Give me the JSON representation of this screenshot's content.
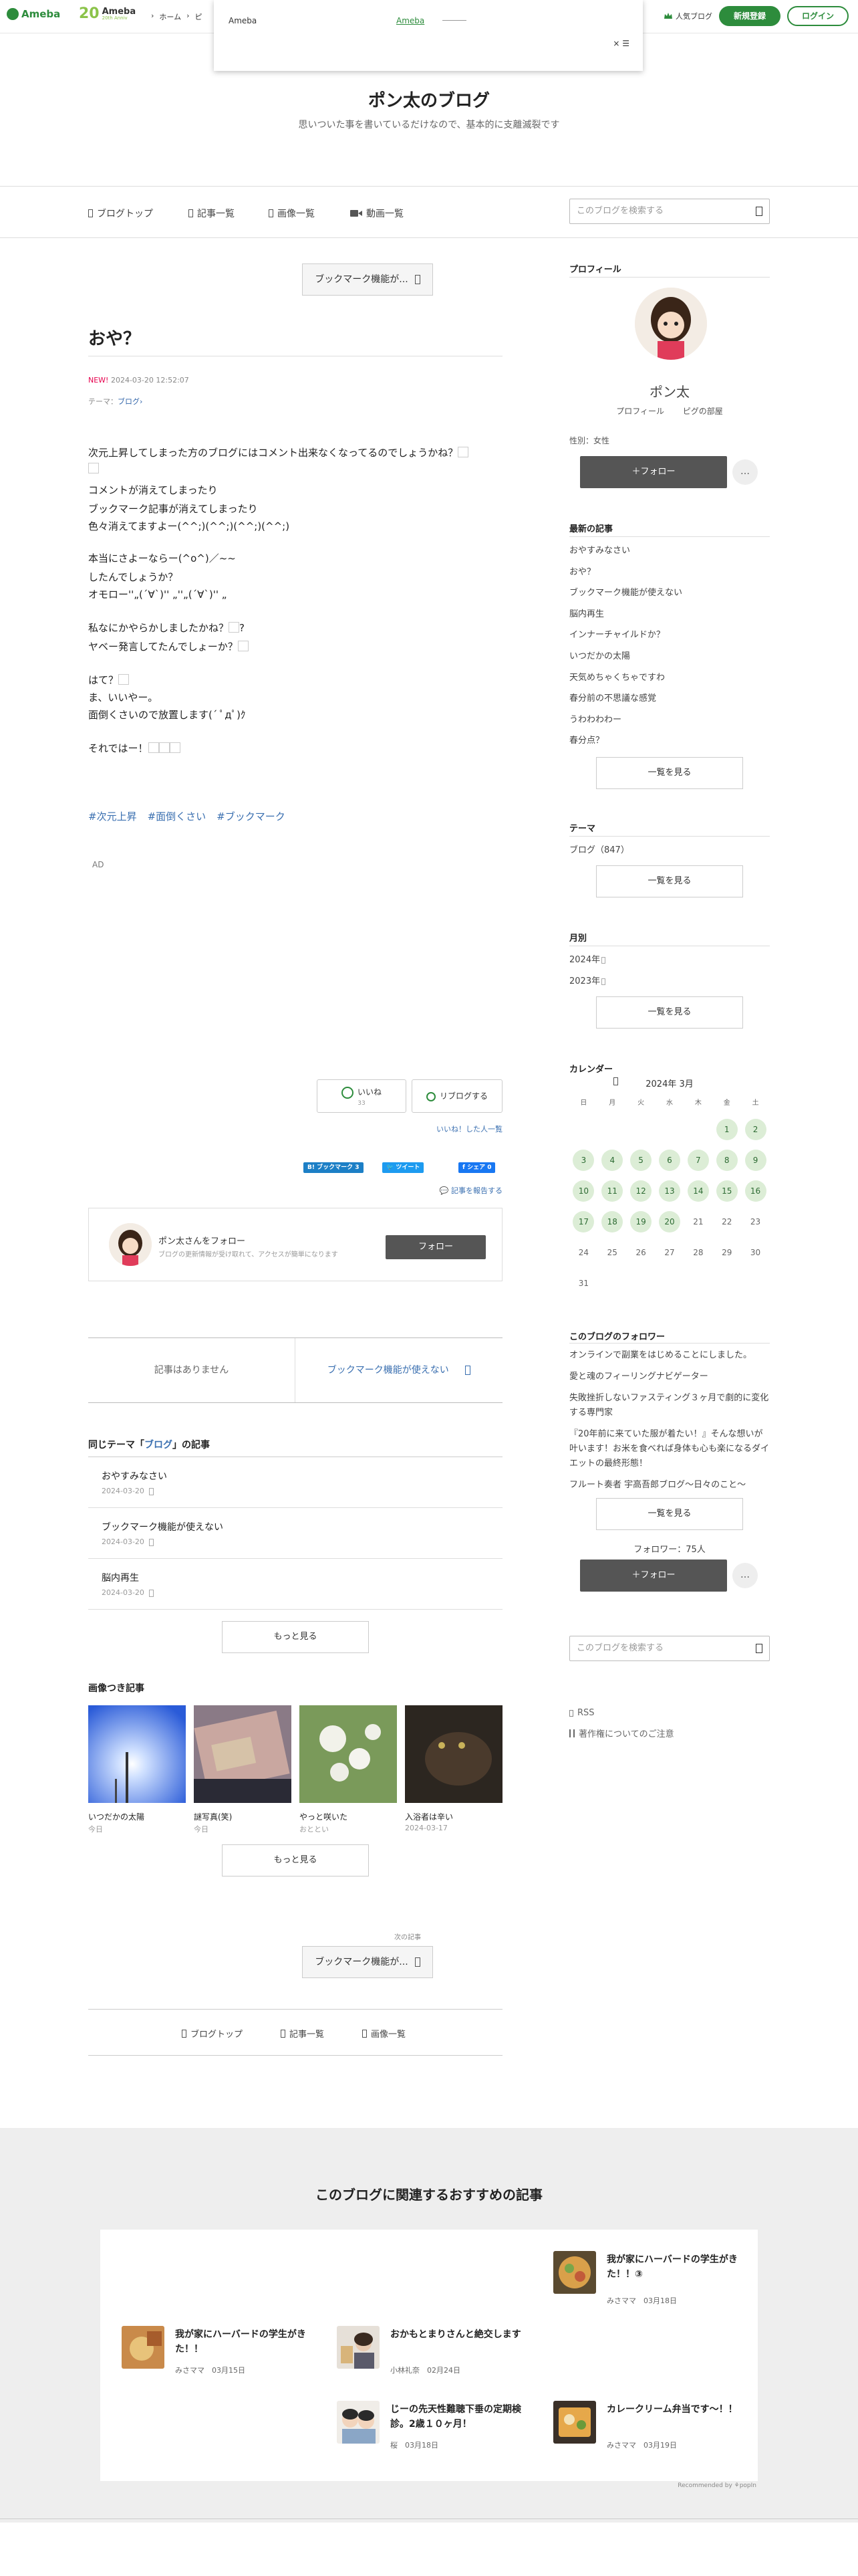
{
  "topbar": {
    "logo": "Ameba",
    "anniv_num": "20",
    "anniv_text": "Ameba",
    "anniv_sub": "20th Anniv",
    "nav": [
      "›",
      "ホーム",
      "›",
      "ピ"
    ],
    "popular_blog": "人気ブログ",
    "register": "新規登録",
    "login": "ログイン"
  },
  "popup": {
    "a1": "Ameba",
    "a2": "Ameba",
    "close": "× ☰"
  },
  "blog": {
    "title": "ポン太のブログ",
    "desc": "思いついた事を書いているだけなので、基本的に支離滅裂です"
  },
  "gnav": {
    "items": [
      "ブログトップ",
      "記事一覧",
      "画像一覧",
      "動画一覧"
    ],
    "search_placeholder": "このブログを検索する"
  },
  "entry": {
    "bookmark_prev": "ブックマーク機能が...",
    "title": "おや？",
    "new": "NEW!",
    "date": "2024-03-20 12:52:07",
    "theme_label": "テーマ：",
    "theme": "ブログ",
    "lines": [
      "次元上昇してしまった方のブログにはコメント出来なくなってるのでしょうかね？",
      "",
      "コメントが消えてしまったり",
      "ブックマーク記事が消えてしまったり",
      "色々消えてますよー(^^;)(^^;)(^^;)(^^;)",
      "本当にさよーならー(^o^)／~~",
      "したんでしょうか？",
      "オモロー''„(´∀`)'' „''„(´∀`)'' „",
      "私なにかやらかしましたかね？",
      "ヤベー発言してたんでしょーか？",
      "はて？",
      "ま、いいやー。",
      "面倒くさいので放置します(´ ﾟдﾟ)ｸ",
      "それではー！"
    ],
    "hashtags": [
      "#次元上昇",
      "#面倒くさい",
      "#ブックマーク"
    ],
    "ad": "AD",
    "like": "いいね",
    "like_count": "33",
    "reblog": "リブログする",
    "like_users": "いいね！した人一覧",
    "share_bm": "B! ブックマーク",
    "share_bm_n": "3",
    "share_tw": "ツイート",
    "share_fb": "シェア",
    "share_fb_n": "0",
    "report": "記事を報告する",
    "follow_title": "ポン太さんをフォロー",
    "follow_desc": "ブログの更新情報が受け取れて、アクセスが簡単になります",
    "follow_btn": "フォロー",
    "pager_prev": "記事はありません",
    "pager_next": "ブックマーク機能が使えない"
  },
  "theme_section": {
    "title_pre": "同じテーマ「",
    "title_theme": "ブログ",
    "title_post": "」の記事",
    "rows": [
      {
        "title": "おやすみなさい",
        "date": "2024-03-20"
      },
      {
        "title": "ブックマーク機能が使えない",
        "date": "2024-03-20"
      },
      {
        "title": "脳内再生",
        "date": "2024-03-20"
      }
    ],
    "more": "もっと見る"
  },
  "image_section": {
    "title": "画像つき記事",
    "items": [
      {
        "title": "いつだかの太陽",
        "date": "今日"
      },
      {
        "title": "謎写真(笑)",
        "date": "今日"
      },
      {
        "title": "やっと咲いた",
        "date": "おととい"
      },
      {
        "title": "入浴者は辛い",
        "date": "2024-03-17"
      }
    ],
    "more": "もっと見る"
  },
  "next_entry": {
    "label": "次の記事",
    "title": "ブックマーク機能が..."
  },
  "foot_nav": [
    "ブログトップ",
    "記事一覧",
    "画像一覧"
  ],
  "sidebar": {
    "profile_h": "プロフィール",
    "name": "ポン太",
    "link1": "プロフィール",
    "link2": "ピグの部屋",
    "sex": "性別：女性",
    "follow": "＋フォロー",
    "dots": "…",
    "recent_h": "最新の記事",
    "recent": [
      "おやすみなさい",
      "おや？",
      "ブックマーク機能が使えない",
      "脳内再生",
      "インナーチャイルドか？",
      "いつだかの太陽",
      "天気めちゃくちゃですわ",
      "春分前の不思議な感覚",
      "うわわわわー",
      "春分点？"
    ],
    "see_all": "一覧を見る",
    "theme_h": "テーマ",
    "theme_item": "ブログ（847）",
    "month_h": "月別",
    "months": [
      "2024年",
      "2023年"
    ],
    "cal_h": "カレンダー",
    "cal_month": "2024年 3月",
    "weekdays": [
      "日",
      "月",
      "火",
      "水",
      "木",
      "金",
      "土"
    ],
    "followers_h": "このブログのフォロワー",
    "followers": [
      "オンラインで副業をはじめることにしました。",
      "愛と魂のフィーリングナビゲーター",
      "失敗挫折しないファスティング３ヶ月で劇的に変化する専門家",
      "『20年前に来ていた服が着たい！』そんな想いが叶います！お米を食べれば身体も心も楽になるダイエットの最終形態！",
      "フルート奏者 宇高吾郎ブログ〜日々のこと〜"
    ],
    "follower_count": "フォロワー：75人",
    "search_placeholder": "このブログを検索する",
    "rss": "RSS",
    "copyright": "著作権についてのご注意"
  },
  "calendar": {
    "days": [
      {
        "d": "",
        "on": false
      },
      {
        "d": "",
        "on": false
      },
      {
        "d": "",
        "on": false
      },
      {
        "d": "",
        "on": false
      },
      {
        "d": "",
        "on": false
      },
      {
        "d": "1",
        "on": true
      },
      {
        "d": "2",
        "on": true
      },
      {
        "d": "3",
        "on": true
      },
      {
        "d": "4",
        "on": true
      },
      {
        "d": "5",
        "on": true
      },
      {
        "d": "6",
        "on": true
      },
      {
        "d": "7",
        "on": true
      },
      {
        "d": "8",
        "on": true
      },
      {
        "d": "9",
        "on": true
      },
      {
        "d": "10",
        "on": true
      },
      {
        "d": "11",
        "on": true
      },
      {
        "d": "12",
        "on": true
      },
      {
        "d": "13",
        "on": true
      },
      {
        "d": "14",
        "on": true
      },
      {
        "d": "15",
        "on": true
      },
      {
        "d": "16",
        "on": true
      },
      {
        "d": "17",
        "on": true
      },
      {
        "d": "18",
        "on": true
      },
      {
        "d": "19",
        "on": true
      },
      {
        "d": "20",
        "on": true
      },
      {
        "d": "21",
        "on": false
      },
      {
        "d": "22",
        "on": false
      },
      {
        "d": "23",
        "on": false
      },
      {
        "d": "24",
        "on": false
      },
      {
        "d": "25",
        "on": false
      },
      {
        "d": "26",
        "on": false
      },
      {
        "d": "27",
        "on": false
      },
      {
        "d": "28",
        "on": false
      },
      {
        "d": "29",
        "on": false
      },
      {
        "d": "30",
        "on": false
      },
      {
        "d": "31",
        "on": false
      }
    ]
  },
  "recommend": {
    "title": "このブログに関連するおすすめの記事",
    "cards": [
      {
        "title": "我が家にハーバードの学生がきた！！③",
        "author": "みさママ",
        "date": "03月18日"
      },
      {
        "title": "我が家にハーバードの学生がきた！！",
        "author": "みさママ",
        "date": "03月15日"
      },
      {
        "title": "おかもとまりさんと絶交します",
        "author": "小林礼奈",
        "date": "02月24日"
      },
      {
        "title": "じーの先天性難聴下垂の定期検診。2歳１０ヶ月！",
        "author": "桜",
        "date": "03月18日"
      },
      {
        "title": "カレークリーム弁当です〜！！",
        "author": "みさママ",
        "date": "03月19日"
      }
    ],
    "powered": "Recommended by ⚘popIn"
  }
}
